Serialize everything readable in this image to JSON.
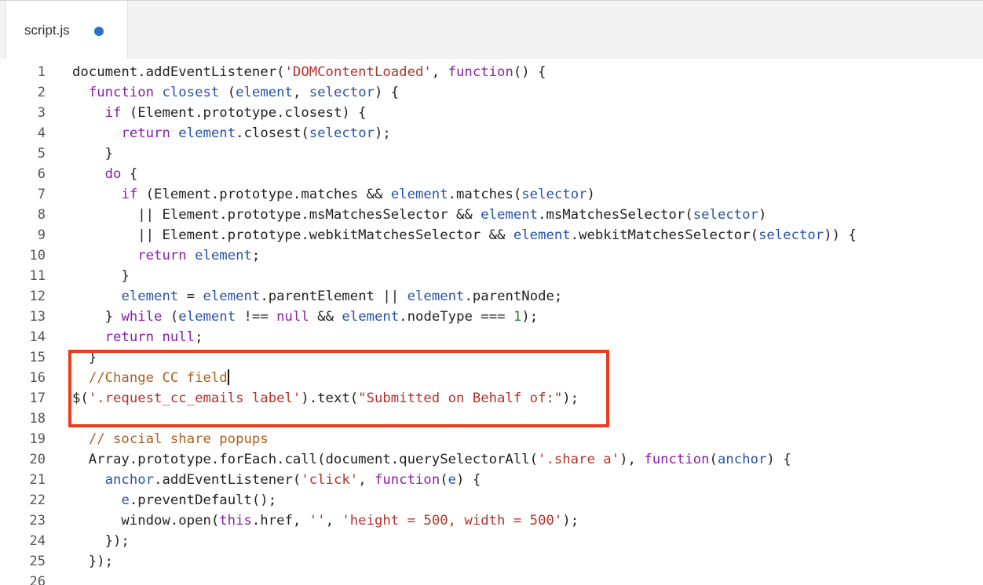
{
  "tab": {
    "filename": "script.js",
    "modified_indicator_color": "#2f6ed1"
  },
  "colors": {
    "keyword": "#8a1fa6",
    "identifier": "#2953a8",
    "string": "#b5322a",
    "comment": "#b05f1e",
    "number": "#2b7a3f",
    "highlight_border": "#ee3b1e"
  },
  "lines": [
    {
      "n": "1",
      "tokens": [
        [
          "t",
          "document.addEventListener("
        ],
        [
          "s",
          "'DOMContentLoaded'"
        ],
        [
          "t",
          ", "
        ],
        [
          "k",
          "function"
        ],
        [
          "t",
          "() {"
        ]
      ]
    },
    {
      "n": "2",
      "tokens": [
        [
          "t",
          "  "
        ],
        [
          "k",
          "function"
        ],
        [
          "t",
          " "
        ],
        [
          "i",
          "closest"
        ],
        [
          "t",
          " ("
        ],
        [
          "i",
          "element"
        ],
        [
          "t",
          ", "
        ],
        [
          "i",
          "selector"
        ],
        [
          "t",
          ") {"
        ]
      ]
    },
    {
      "n": "3",
      "tokens": [
        [
          "t",
          "    "
        ],
        [
          "k",
          "if"
        ],
        [
          "t",
          " (Element.prototype.closest) {"
        ]
      ]
    },
    {
      "n": "4",
      "tokens": [
        [
          "t",
          "      "
        ],
        [
          "k",
          "return"
        ],
        [
          "t",
          " "
        ],
        [
          "i",
          "element"
        ],
        [
          "t",
          ".closest("
        ],
        [
          "i",
          "selector"
        ],
        [
          "t",
          ");"
        ]
      ]
    },
    {
      "n": "5",
      "tokens": [
        [
          "t",
          "    }"
        ]
      ]
    },
    {
      "n": "6",
      "tokens": [
        [
          "t",
          "    "
        ],
        [
          "k",
          "do"
        ],
        [
          "t",
          " {"
        ]
      ]
    },
    {
      "n": "7",
      "tokens": [
        [
          "t",
          "      "
        ],
        [
          "k",
          "if"
        ],
        [
          "t",
          " (Element.prototype.matches && "
        ],
        [
          "i",
          "element"
        ],
        [
          "t",
          ".matches("
        ],
        [
          "i",
          "selector"
        ],
        [
          "t",
          ")"
        ]
      ]
    },
    {
      "n": "8",
      "tokens": [
        [
          "t",
          "        || Element.prototype.msMatchesSelector && "
        ],
        [
          "i",
          "element"
        ],
        [
          "t",
          ".msMatchesSelector("
        ],
        [
          "i",
          "selector"
        ],
        [
          "t",
          ")"
        ]
      ]
    },
    {
      "n": "9",
      "tokens": [
        [
          "t",
          "        || Element.prototype.webkitMatchesSelector && "
        ],
        [
          "i",
          "element"
        ],
        [
          "t",
          ".webkitMatchesSelector("
        ],
        [
          "i",
          "selector"
        ],
        [
          "t",
          ")) {"
        ]
      ]
    },
    {
      "n": "10",
      "tokens": [
        [
          "t",
          "        "
        ],
        [
          "k",
          "return"
        ],
        [
          "t",
          " "
        ],
        [
          "i",
          "element"
        ],
        [
          "t",
          ";"
        ]
      ]
    },
    {
      "n": "11",
      "tokens": [
        [
          "t",
          "      }"
        ]
      ]
    },
    {
      "n": "12",
      "tokens": [
        [
          "t",
          "      "
        ],
        [
          "i",
          "element"
        ],
        [
          "t",
          " = "
        ],
        [
          "i",
          "element"
        ],
        [
          "t",
          ".parentElement || "
        ],
        [
          "i",
          "element"
        ],
        [
          "t",
          ".parentNode;"
        ]
      ]
    },
    {
      "n": "13",
      "tokens": [
        [
          "t",
          "    } "
        ],
        [
          "k",
          "while"
        ],
        [
          "t",
          " ("
        ],
        [
          "i",
          "element"
        ],
        [
          "t",
          " !== "
        ],
        [
          "k",
          "null"
        ],
        [
          "t",
          " && "
        ],
        [
          "i",
          "element"
        ],
        [
          "t",
          ".nodeType === "
        ],
        [
          "n",
          "1"
        ],
        [
          "t",
          ");"
        ]
      ]
    },
    {
      "n": "14",
      "tokens": [
        [
          "t",
          "    "
        ],
        [
          "k",
          "return"
        ],
        [
          "t",
          " "
        ],
        [
          "k",
          "null"
        ],
        [
          "t",
          ";"
        ]
      ]
    },
    {
      "n": "15",
      "tokens": [
        [
          "t",
          "  }"
        ]
      ]
    },
    {
      "n": "16",
      "tokens": [
        [
          "t",
          "  "
        ],
        [
          "c",
          "//Change CC field"
        ],
        [
          "cursor",
          ""
        ]
      ]
    },
    {
      "n": "17",
      "tokens": [
        [
          "t",
          "$("
        ],
        [
          "s",
          "'.request_cc_emails label'"
        ],
        [
          "t",
          ").text("
        ],
        [
          "s",
          "\"Submitted on Behalf of:\""
        ],
        [
          "t",
          ");"
        ]
      ]
    },
    {
      "n": "18",
      "tokens": []
    },
    {
      "n": "19",
      "tokens": [
        [
          "t",
          "  "
        ],
        [
          "c",
          "// social share popups"
        ]
      ]
    },
    {
      "n": "20",
      "tokens": [
        [
          "t",
          "  Array.prototype.forEach.call(document.querySelectorAll("
        ],
        [
          "s",
          "'.share a'"
        ],
        [
          "t",
          "), "
        ],
        [
          "k",
          "function"
        ],
        [
          "t",
          "("
        ],
        [
          "i",
          "anchor"
        ],
        [
          "t",
          ") {"
        ]
      ]
    },
    {
      "n": "21",
      "tokens": [
        [
          "t",
          "    "
        ],
        [
          "i",
          "anchor"
        ],
        [
          "t",
          ".addEventListener("
        ],
        [
          "s",
          "'click'"
        ],
        [
          "t",
          ", "
        ],
        [
          "k",
          "function"
        ],
        [
          "t",
          "("
        ],
        [
          "i",
          "e"
        ],
        [
          "t",
          ") {"
        ]
      ]
    },
    {
      "n": "22",
      "tokens": [
        [
          "t",
          "      "
        ],
        [
          "i",
          "e"
        ],
        [
          "t",
          ".preventDefault();"
        ]
      ]
    },
    {
      "n": "23",
      "tokens": [
        [
          "t",
          "      window.open("
        ],
        [
          "k",
          "this"
        ],
        [
          "t",
          ".href, "
        ],
        [
          "s",
          "''"
        ],
        [
          "t",
          ", "
        ],
        [
          "s",
          "'height = 500, width = 500'"
        ],
        [
          "t",
          ");"
        ]
      ]
    },
    {
      "n": "24",
      "tokens": [
        [
          "t",
          "    });"
        ]
      ]
    },
    {
      "n": "25",
      "tokens": [
        [
          "t",
          "  });"
        ]
      ]
    },
    {
      "n": "26",
      "tokens": []
    }
  ]
}
